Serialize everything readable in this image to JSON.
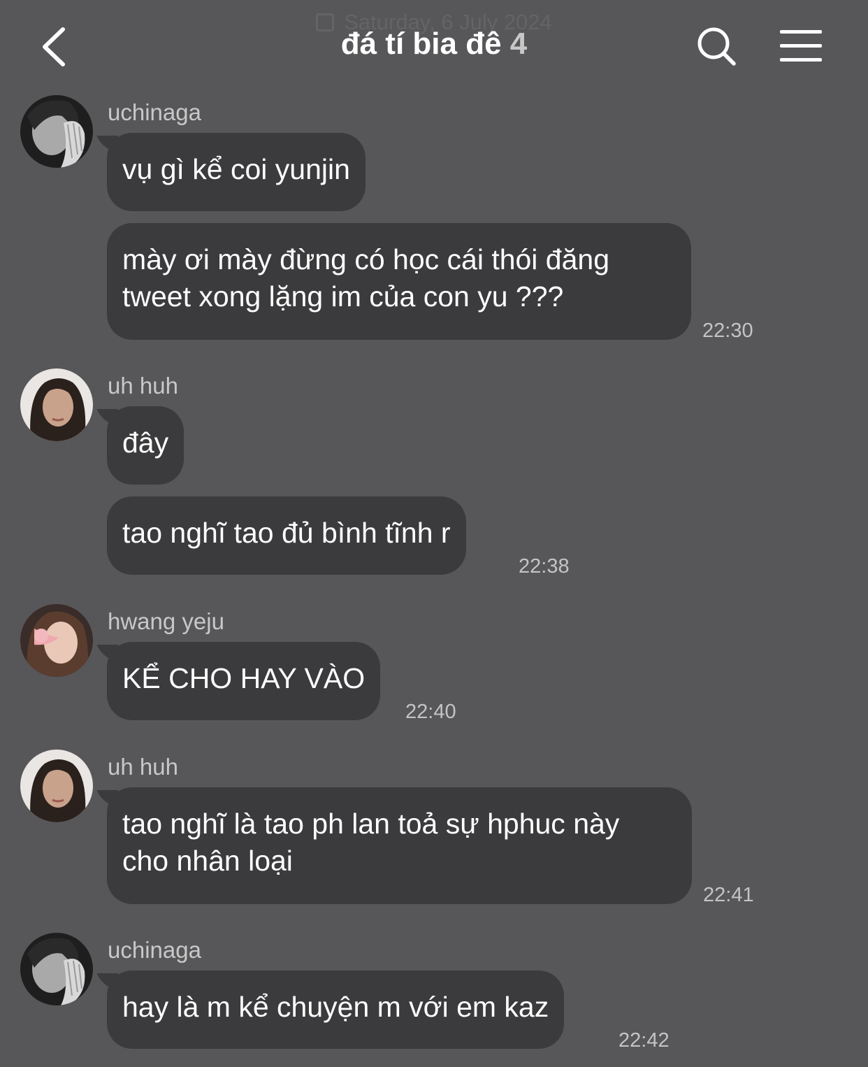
{
  "date_header": "Saturday, 6 July 2024",
  "header": {
    "title": "đá tí bia đê",
    "member_count": "4"
  },
  "icons": {
    "back": "chevron-left-icon",
    "search": "search-icon",
    "menu": "hamburger-menu-icon",
    "calendar": "calendar-icon"
  },
  "messages": [
    {
      "sender": "uchinaga",
      "bubbles": [
        "vụ gì kể coi yunjin",
        "mày ơi mày đừng có học cái thói đăng\ntweet xong lặng im của con yu ???"
      ],
      "time": "22:30"
    },
    {
      "sender": "uh huh",
      "bubbles": [
        "đây",
        "tao nghĩ tao đủ bình tĩnh r"
      ],
      "time": "22:38"
    },
    {
      "sender": "hwang yeju",
      "bubbles": [
        "KỂ CHO HAY VÀO"
      ],
      "time": "22:40"
    },
    {
      "sender": "uh huh",
      "bubbles": [
        "tao nghĩ là tao ph lan toả sự hphuc này\ncho nhân loại"
      ],
      "time": "22:41"
    },
    {
      "sender": "uchinaga",
      "bubbles": [
        "hay là m kể chuyện m với em kaz"
      ],
      "time": "22:42"
    }
  ],
  "colors": {
    "background": "#575658",
    "bubble": "#3b3b3d",
    "text": "#ffffff",
    "muted": "#c8c8c8"
  }
}
